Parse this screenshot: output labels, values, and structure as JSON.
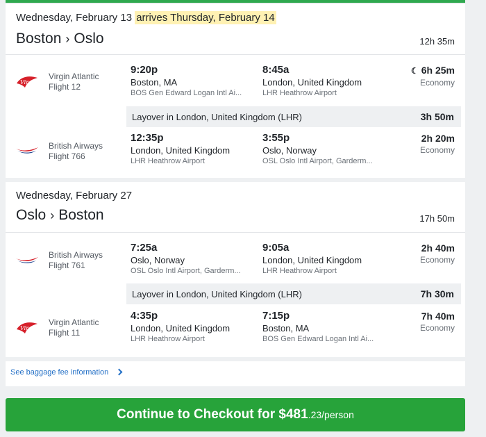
{
  "colors": {
    "accent_green": "#27a33a",
    "highlight": "#fff1b3",
    "link": "#2470c6"
  },
  "outbound": {
    "date": "Wednesday, February 13",
    "arrives_note": "arrives Thursday, February 14",
    "origin": "Boston",
    "destination": "Oslo",
    "separator": "›",
    "total_duration": "12h 35m",
    "segments": [
      {
        "logo": "virgin-atlantic-logo",
        "airline": "Virgin Atlantic",
        "flight": "Flight 12",
        "depart_time": "9:20p",
        "depart_city": "Boston, MA",
        "depart_airport": "BOS Gen Edward Logan Intl Ai...",
        "arrive_time": "8:45a",
        "arrive_city": "London, United Kingdom",
        "arrive_airport": "LHR Heathrow Airport",
        "duration": "6h 25m",
        "cabin": "Economy",
        "overnight_icon": "moon-icon"
      },
      {
        "logo": "british-airways-logo",
        "airline": "British Airways",
        "flight": "Flight 766",
        "depart_time": "12:35p",
        "depart_city": "London, United Kingdom",
        "depart_airport": "LHR Heathrow Airport",
        "arrive_time": "3:55p",
        "arrive_city": "Oslo, Norway",
        "arrive_airport": "OSL Oslo Intl Airport, Garderm...",
        "duration": "2h 20m",
        "cabin": "Economy"
      }
    ],
    "layover": {
      "text": "Layover in London, United Kingdom (LHR)",
      "duration": "3h 50m"
    }
  },
  "return": {
    "date": "Wednesday, February 27",
    "origin": "Oslo",
    "destination": "Boston",
    "separator": "›",
    "total_duration": "17h 50m",
    "segments": [
      {
        "logo": "british-airways-logo",
        "airline": "British Airways",
        "flight": "Flight 761",
        "depart_time": "7:25a",
        "depart_city": "Oslo, Norway",
        "depart_airport": "OSL Oslo Intl Airport, Garderm...",
        "arrive_time": "9:05a",
        "arrive_city": "London, United Kingdom",
        "arrive_airport": "LHR Heathrow Airport",
        "duration": "2h 40m",
        "cabin": "Economy"
      },
      {
        "logo": "virgin-atlantic-logo",
        "airline": "Virgin Atlantic",
        "flight": "Flight 11",
        "depart_time": "4:35p",
        "depart_city": "London, United Kingdom",
        "depart_airport": "LHR Heathrow Airport",
        "arrive_time": "7:15p",
        "arrive_city": "Boston, MA",
        "arrive_airport": "BOS Gen Edward Logan Intl Ai...",
        "duration": "7h 40m",
        "cabin": "Economy"
      }
    ],
    "layover": {
      "text": "Layover in London, United Kingdom (LHR)",
      "duration": "7h 30m"
    }
  },
  "baggage_link": "See baggage fee information",
  "checkout": {
    "label": "Continue to Checkout for",
    "price_main": "$481",
    "price_cents": ".23",
    "per": "/person"
  }
}
